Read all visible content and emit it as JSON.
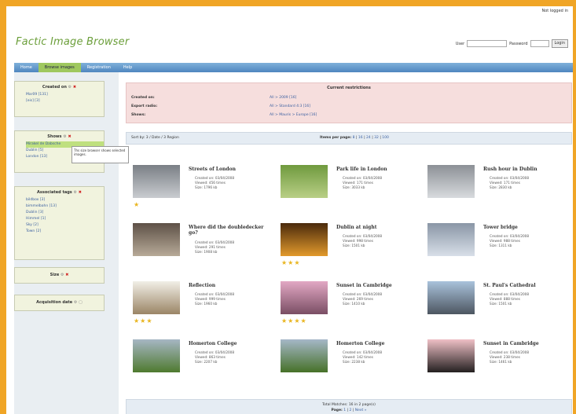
{
  "header": {
    "top_link": "Not logged in",
    "brand": "Factic Image Browser",
    "user_label": "User",
    "password_label": "Password",
    "login_button": "Login"
  },
  "nav": {
    "tabs": [
      {
        "label": "Home"
      },
      {
        "label": "Browse images"
      },
      {
        "label": "Registration"
      },
      {
        "label": "Help"
      }
    ]
  },
  "sidebar": {
    "created": {
      "title": "Created on",
      "items": [
        "Mar09 [131]",
        "[eis] [3]"
      ]
    },
    "shows": {
      "title": "Shows",
      "items": [
        "Mirakel de Dabsche",
        "Dublin [5]",
        "London [13]"
      ],
      "tooltip": "Ths size browser shows selected images."
    },
    "tags": {
      "title": "Associated tags",
      "items": [
        "bildbox [3]",
        "bimmelbahn [13]",
        "Dublin [3]",
        "Himmel [1]",
        "Sky [2]",
        "Town [2]"
      ]
    },
    "size": {
      "title": "Size"
    },
    "acq": {
      "title": "Acquisition date"
    }
  },
  "restrictions": {
    "title": "Current restrictions",
    "rows": [
      {
        "label": "Created on:",
        "value": "All > 2009 [16]"
      },
      {
        "label": "Export radio:",
        "value": "All > Standard 4:3 [16]"
      },
      {
        "label": "Shows:",
        "value": "All > Mauris > Europe [16]"
      }
    ]
  },
  "sortbar": {
    "sort": "Sort by: 3 / Date / 3 Region",
    "ipp_label": "Items per page:",
    "ipp_values": [
      "8",
      "16",
      "24",
      "32",
      "100"
    ]
  },
  "cells": [
    {
      "title": "Streets of London",
      "meta": [
        "Created on: 03/04/2008",
        "Viewed: 456 times",
        "Size: 1796 kb"
      ],
      "stars": 1,
      "c1": "#7a7f85",
      "c2": "#c9ccd0"
    },
    {
      "title": "Park life in London",
      "meta": [
        "Created on: 03/04/2008",
        "Viewed: 171 times",
        "Size: 3033 kb"
      ],
      "stars": 0,
      "c1": "#6f9a3e",
      "c2": "#b9cf86"
    },
    {
      "title": "Rush hour in Dublin",
      "meta": [
        "Created on: 03/04/2008",
        "Viewed: 171 times",
        "Size: 2830 kb"
      ],
      "stars": 0,
      "c1": "#8c9096",
      "c2": "#d8dbde"
    },
    {
      "title": "Where did the doubledecker go?",
      "meta": [
        "Created on: 03/04/2008",
        "Viewed: 291 times",
        "Size: 1908 kb"
      ],
      "stars": 0,
      "c1": "#5e5147",
      "c2": "#b7aa98"
    },
    {
      "title": "Dublin at night",
      "meta": [
        "Created on: 03/04/2008",
        "Viewed: 998 times",
        "Size: 1501 kb"
      ],
      "stars": 3,
      "c1": "#4a2a0c",
      "c2": "#e29a2c"
    },
    {
      "title": "Tower bridge",
      "meta": [
        "Created on: 03/04/2008",
        "Viewed: 988 times",
        "Size: 1311 kb"
      ],
      "stars": 0,
      "c1": "#8a96a6",
      "c2": "#d8dfe8"
    },
    {
      "title": "Reflection",
      "meta": [
        "Created on: 03/04/2008",
        "Viewed: 999 times",
        "Size: 1960 kb"
      ],
      "stars": 3,
      "c1": "#f1efe7",
      "c2": "#9b8566"
    },
    {
      "title": "Sunset in Cambridge",
      "meta": [
        "Created on: 03/04/2008",
        "Viewed: 269 times",
        "Size: 1410 kb"
      ],
      "stars": 4,
      "c1": "#e2a8c4",
      "c2": "#7a4e64"
    },
    {
      "title": "St. Paul's Cathedral",
      "meta": [
        "Created on: 03/04/2008",
        "Viewed: 888 times",
        "Size: 1501 kb"
      ],
      "stars": 0,
      "c1": "#a9c2db",
      "c2": "#4d5661"
    },
    {
      "title": "Homerton College",
      "meta": [
        "Created on: 03/04/2008",
        "Viewed: 863 times",
        "Size: 2207 kb"
      ],
      "stars": 0,
      "c1": "#a6b6c4",
      "c2": "#4f7a2f"
    },
    {
      "title": "Homerton College",
      "meta": [
        "Created on: 03/04/2008",
        "Viewed: 142 times",
        "Size: 2238 kb"
      ],
      "stars": 0,
      "c1": "#a5b7c8",
      "c2": "#467128"
    },
    {
      "title": "Sunset in Cambridge",
      "meta": [
        "Created on: 03/04/2008",
        "Viewed: 238 times",
        "Size: 1461 kb"
      ],
      "stars": 0,
      "c1": "#efc0c6",
      "c2": "#242020"
    }
  ],
  "footer": {
    "total": "Total Matches: 16 in 2 page(s)",
    "pages_label": "Page:",
    "pages": [
      "1",
      "2",
      "Next »"
    ]
  }
}
